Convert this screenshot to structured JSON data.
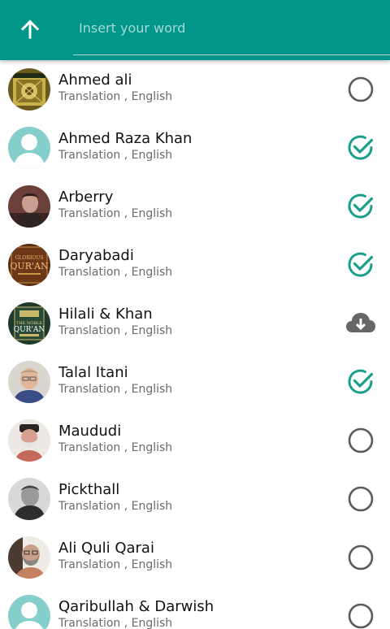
{
  "header": {
    "search_placeholder": "Insert your word",
    "background_color": "#00968a",
    "back_icon": "arrow-up-icon"
  },
  "translations": [
    {
      "name": "Ahmed ali",
      "subtitle": "Translation , English",
      "status": "not-selected",
      "avatar": "book-cover"
    },
    {
      "name": "Ahmed Raza Khan",
      "subtitle": "Translation , English",
      "status": "selected",
      "avatar": "placeholder-person"
    },
    {
      "name": "Arberry",
      "subtitle": "Translation , English",
      "status": "selected",
      "avatar": "photo"
    },
    {
      "name": "Daryabadi",
      "subtitle": "Translation , English",
      "status": "selected",
      "avatar": "book-cover"
    },
    {
      "name": "Hilali & Khan",
      "subtitle": "Translation , English",
      "status": "download",
      "avatar": "book-cover"
    },
    {
      "name": "Talal Itani",
      "subtitle": "Translation , English",
      "status": "selected",
      "avatar": "photo"
    },
    {
      "name": "Maududi",
      "subtitle": "Translation , English",
      "status": "not-selected",
      "avatar": "photo"
    },
    {
      "name": "Pickthall",
      "subtitle": "Translation , English",
      "status": "not-selected",
      "avatar": "photo"
    },
    {
      "name": "Ali Quli Qarai",
      "subtitle": "Translation , English",
      "status": "not-selected",
      "avatar": "photo"
    },
    {
      "name": "Qaribullah & Darwish",
      "subtitle": "Translation , English",
      "status": "not-selected",
      "avatar": "placeholder-person"
    }
  ],
  "colors": {
    "accent": "#00968a",
    "check": "#1a9e8e",
    "radio": "#5a5a5a",
    "download": "#666666"
  }
}
